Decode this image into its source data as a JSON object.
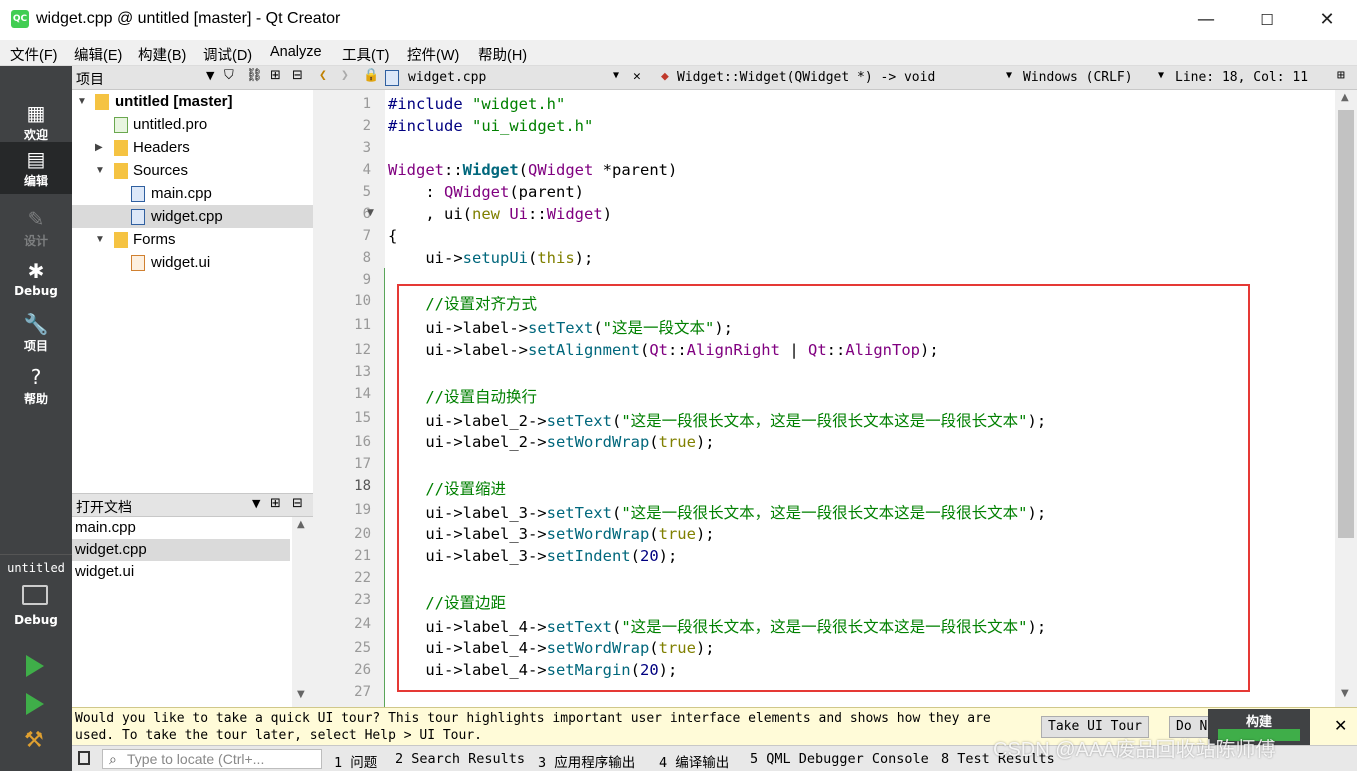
{
  "window": {
    "title": "widget.cpp @ untitled [master] - Qt Creator",
    "app_icon": "QC",
    "minimize": "—",
    "maximize": "☐",
    "close": "✕"
  },
  "menu": [
    "文件(F)",
    "编辑(E)",
    "构建(B)",
    "调试(D)",
    "Analyze",
    "工具(T)",
    "控件(W)",
    "帮助(H)"
  ],
  "modes": [
    {
      "label": "欢迎",
      "icon": "grid-icon"
    },
    {
      "label": "编辑",
      "icon": "edit-icon"
    },
    {
      "label": "设计",
      "icon": "pencil-icon"
    },
    {
      "label": "Debug",
      "icon": "bug-icon"
    },
    {
      "label": "项目",
      "icon": "wrench-icon"
    },
    {
      "label": "帮助",
      "icon": "help-icon"
    }
  ],
  "kit": {
    "project": "untitled",
    "mode": "Debug"
  },
  "project_pane": {
    "title": "项目"
  },
  "tree": [
    {
      "label": "untitled [master]",
      "level": 0,
      "expanded": true
    },
    {
      "label": "untitled.pro",
      "level": 1
    },
    {
      "label": "Headers",
      "level": 1,
      "expanded": false
    },
    {
      "label": "Sources",
      "level": 1,
      "expanded": true
    },
    {
      "label": "main.cpp",
      "level": 2
    },
    {
      "label": "widget.cpp",
      "level": 2,
      "selected": true
    },
    {
      "label": "Forms",
      "level": 1,
      "expanded": true
    },
    {
      "label": "widget.ui",
      "level": 2
    }
  ],
  "open_docs": {
    "title": "打开文档",
    "items": [
      "main.cpp",
      "widget.cpp",
      "widget.ui"
    ],
    "selected": 1
  },
  "editor": {
    "file": "widget.cpp",
    "symbol": "Widget::Widget(QWidget *) -> void",
    "line_ending": "Windows (CRLF)",
    "position": "Line: 18, Col: 11",
    "current_line": 18
  },
  "code_lines": [
    "#include \"widget.h\"",
    "#include \"ui_widget.h\"",
    "",
    "Widget::Widget(QWidget *parent)",
    "    : QWidget(parent)",
    "    , ui(new Ui::Widget)",
    "{",
    "    ui->setupUi(this);",
    "",
    "    //设置对齐方式",
    "    ui->label->setText(\"这是一段文本\");",
    "    ui->label->setAlignment(Qt::AlignRight | Qt::AlignTop);",
    "",
    "    //设置自动换行",
    "    ui->label_2->setText(\"这是一段很长文本，这是一段很长文本这是一段很长文本\");",
    "    ui->label_2->setWordWrap(true);",
    "",
    "    //设置缩进",
    "    ui->label_3->setText(\"这是一段很长文本，这是一段很长文本这是一段很长文本\");",
    "    ui->label_3->setWordWrap(true);",
    "    ui->label_3->setIndent(20);",
    "",
    "    //设置边距",
    "    ui->label_4->setText(\"这是一段很长文本，这是一段很长文本这是一段很长文本\");",
    "    ui->label_4->setWordWrap(true);",
    "    ui->label_4->setMargin(20);",
    ""
  ],
  "infobar": {
    "text_line1": "Would you like to take a quick UI tour? This tour highlights important user interface elements and shows how they are",
    "text_line2": "used. To take the tour later, select Help > UI Tour.",
    "take_tour": "Take UI Tour",
    "do_not_show": "Do N",
    "build_tooltip": "构建"
  },
  "status": {
    "locator_placeholder": "Type to locate (Ctrl+...",
    "tabs": [
      "1 问题",
      "2 Search Results",
      "3 应用程序输出",
      "4 编译输出",
      "5 QML Debugger Console",
      "8 Test Results"
    ]
  },
  "watermark": "CSDN @AAA废品回收站陈师傅",
  "colors": {
    "accent_red": "#e53935",
    "modebar": "#404244",
    "run_green": "#3fae49"
  }
}
